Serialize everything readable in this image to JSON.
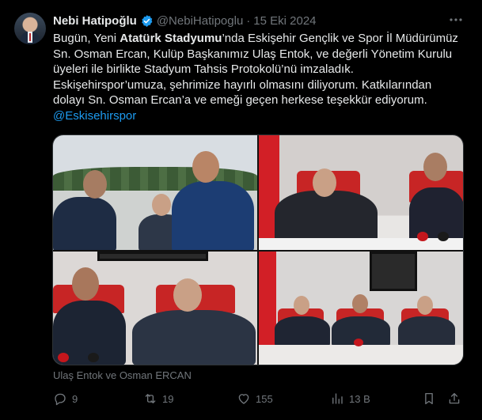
{
  "author": {
    "name": "Nebi Hatipoğlu",
    "handle": "@NebiHatipoglu",
    "separator": "·",
    "date": "15 Eki 2024"
  },
  "tweet": {
    "text_1": "Bugün, Yeni ",
    "text_bold": "Atatürk Stadyumu",
    "text_2": "’nda Eskişehir Gençlik ve Spor İl Müdürümüz Sn. Osman Ercan, Kulüp Başkanımız Ulaş Entok, ve değerli Yönetim Kurulu üyeleri ile birlikte Stadyum Tahsis Protokolü’nü imzaladık. Eskişehirspor’umuza, şehrimize hayırlı olmasını diliyorum. Katkılarından dolayı Sn. Osman Ercan’a ve emeği geçen herkese teşekkür ediyorum.",
    "mention": "@Eskisehirspor"
  },
  "media": {
    "caption": "Ulaş Entok ve Osman ERCAN"
  },
  "actions": {
    "replies": "9",
    "reposts": "19",
    "likes": "155",
    "views": "13 B"
  },
  "icons": {
    "verified": "verified-badge-icon",
    "more": "more-icon",
    "reply": "reply-icon",
    "repost": "repost-icon",
    "like": "heart-icon",
    "views": "views-icon",
    "bookmark": "bookmark-icon",
    "share": "share-icon"
  },
  "colors": {
    "accent": "#1d9bf0",
    "muted": "#71767b",
    "text": "#e7e9ea",
    "background": "#000000"
  }
}
